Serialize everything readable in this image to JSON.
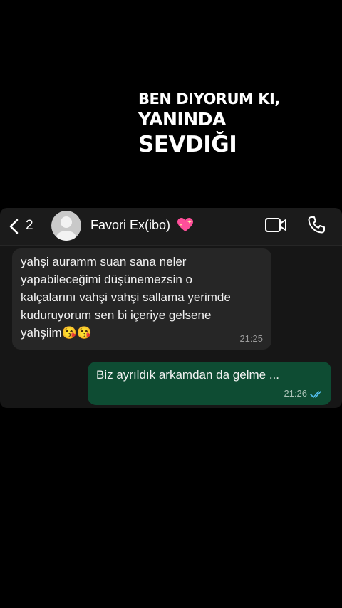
{
  "caption": {
    "line1": "BEN DIYORUM KI,",
    "line2": "YANINDA",
    "line3": "SEVDIĞI"
  },
  "header": {
    "back_count": "2",
    "contact_name": "Favori Ex(ibo)",
    "heart_icon": "sparkling-heart-emoji",
    "video_icon": "video-camera-icon",
    "call_icon": "phone-icon"
  },
  "messages": [
    {
      "direction": "incoming",
      "text": "yahşi auramm suan sana neler\nyapabileceğimi düşünemezsin o\nkalçalarını vahşi vahşi sallama yerimde\nkuduruyorum sen bi içeriye gelsene\nyahşiim😘😘",
      "time": "21:25"
    },
    {
      "direction": "outgoing",
      "text": "Biz ayrıldık arkamdan da gelme ...",
      "time": "21:26",
      "status": "read"
    }
  ],
  "colors": {
    "background": "#000000",
    "incoming_bubble": "#262626",
    "outgoing_bubble": "#0e4c33",
    "read_ticks": "#53bdeb"
  }
}
